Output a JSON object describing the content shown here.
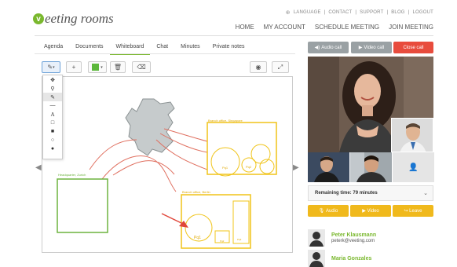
{
  "brand": {
    "logo_letter": "v",
    "logo_text": "eeting rooms"
  },
  "toplinks": [
    "LANGUAGE",
    "|",
    "CONTACT",
    "|",
    "SUPPORT",
    "|",
    "BLOG",
    "|",
    "LOGOUT"
  ],
  "mainnav": [
    "HOME",
    "MY ACCOUNT",
    "SCHEDULE MEETING",
    "JOIN MEETING"
  ],
  "tabs": [
    {
      "label": "Agenda",
      "active": false
    },
    {
      "label": "Documents",
      "active": false
    },
    {
      "label": "Whiteboard",
      "active": true
    },
    {
      "label": "Chat",
      "active": false
    },
    {
      "label": "Minutes",
      "active": false
    },
    {
      "label": "Private notes",
      "active": false
    }
  ],
  "whiteboard": {
    "labels": {
      "hq": "Headquarter, Zurich",
      "singapore": "Branch office, Singapore",
      "berlin": "Branch office, Berlin",
      "sg_p1": "Pq1",
      "sg_p2": "Pq2",
      "be_p1": "Pq1",
      "be_p2": "Pq2",
      "be_p3": "Pq3"
    },
    "tools": [
      "move",
      "pin",
      "pencil",
      "line",
      "text",
      "rect-outline",
      "rect-filled",
      "circle-outline",
      "circle-filled"
    ],
    "selected_color": "#5cb83b"
  },
  "calls": {
    "audio": "Audio call",
    "video": "Video call",
    "close": "Close call"
  },
  "remaining": {
    "label": "Remaining time:",
    "value": "79 minutes"
  },
  "actions": {
    "audio": "Audio",
    "video": "Video",
    "leave": "Leave"
  },
  "participants": [
    {
      "name": "Peter Klausmann",
      "email": "peterk@veeting.com"
    },
    {
      "name": "Maria Gonzales",
      "email": ""
    }
  ],
  "colors": {
    "green": "#7ab82e",
    "yellow": "#f0b91c",
    "red": "#e84c3d",
    "grey_btn": "#9aa1a4"
  }
}
